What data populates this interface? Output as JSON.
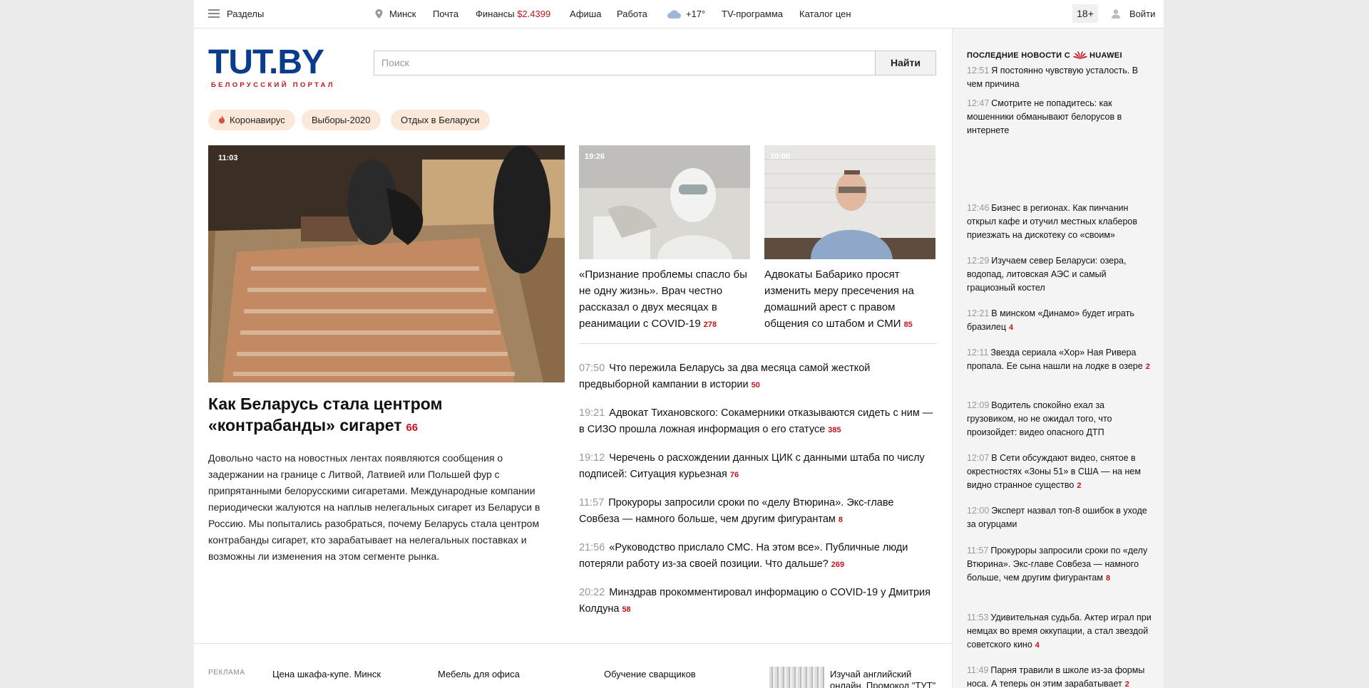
{
  "topbar": {
    "sections": "Разделы",
    "city": "Минск",
    "mail": "Почта",
    "finance_label": "Финансы",
    "finance_value": "$2.4399",
    "afisha": "Афиша",
    "work": "Работа",
    "weather": "+17°",
    "tv": "TV-программа",
    "catalog": "Каталог цен",
    "age": "18+",
    "login": "Войти"
  },
  "logo": {
    "word": "TUT.BY",
    "subtitle": "БЕЛОРУССКИЙ ПОРТАЛ"
  },
  "search": {
    "placeholder": "Поиск",
    "button": "Найти"
  },
  "tags": [
    "Коронавирус",
    "Выборы-2020",
    "Отдых в Беларуси"
  ],
  "hero": {
    "time": "11:03",
    "title": "Как Беларусь стала центром «контрабанды» сигарет",
    "count": "66",
    "text": "Довольно часто на новостных лентах появляются сообщения о задержании на границе с Литвой, Латвией или Польшей фур с припрятанными белорусскими сигаретами. Международные компании периодически жалуются на наплыв нелегальных сигарет из Беларуси в Россию. Мы попытались разобраться, почему Беларусь стала центром контрабанды сигарет, кто зарабатывает на нелегальных поставках и возможны ли изменения на этом сегменте рынка."
  },
  "cards": [
    {
      "time": "19:26",
      "title": "«Признание проблемы спасло бы не одну жизнь». Врач честно рассказал о двух месяцах в реанимации с COVID-19",
      "count": "278"
    },
    {
      "time": "10:00",
      "title": "Адвокаты Бабарико просят изменить меру пресечения на домашний арест с правом общения со штабом и СМИ",
      "count": "85"
    }
  ],
  "news": [
    {
      "time": "07:50",
      "title": "Что пережила Беларусь за два месяца самой жесткой предвыборной кампании в истории",
      "count": "50"
    },
    {
      "time": "19:21",
      "title": "Адвокат Тихановского: Сокамерники отказываются сидеть с ним — в СИЗО прошла ложная информация о его статусе",
      "count": "385"
    },
    {
      "time": "19:12",
      "title": "Черечень о расхождении данных ЦИК с данными штаба по числу подписей: Ситуация курьезная",
      "count": "76"
    },
    {
      "time": "11:57",
      "title": "Прокуроры запросили сроки по «делу Втюрина». Экс-главе Совбеза — намного больше, чем другим фигурантам",
      "count": "8"
    },
    {
      "time": "21:56",
      "title": "«Руководство прислало СМС. На этом все». Публичные люди потеряли работу из-за своей позиции. Что дальше?",
      "count": "269"
    },
    {
      "time": "20:22",
      "title": "Минздрав прокомментировал информацию о COVID-19 у Дмитрия Колдуна",
      "count": "58"
    }
  ],
  "sidebar": {
    "heading": "ПОСЛЕДНИЕ НОВОСТИ С",
    "brand": "HUAWEI",
    "items": [
      {
        "time": "12:51",
        "title": "Я постоянно чувствую усталость. В чем причина",
        "count": ""
      },
      {
        "time": "12:47",
        "title": "Смотрите не попадитесь: как мошенники обманывают белорусов в интернете",
        "count": ""
      },
      {
        "time": "12:46",
        "title": "Бизнес в регионах. Как пинчанин открыл кафе и отучил местных клаберов приезжать на дискотеку со «своим»",
        "count": ""
      },
      {
        "time": "12:29",
        "title": "Изучаем север Беларуси: озера, водопад, литовская АЭС и самый грациозный костел",
        "count": ""
      },
      {
        "time": "12:21",
        "title": "В минском «Динамо» будет играть бразилец",
        "count": "4"
      },
      {
        "time": "12:11",
        "title": "Звезда сериала «Хор» Ная Ривера пропала. Ее сына нашли на лодке в озере",
        "count": "2"
      },
      {
        "time": "12:09",
        "title": "Водитель спокойно ехал за грузовиком, но не ожидал того, что произойдет: видео опасного ДТП",
        "count": ""
      },
      {
        "time": "12:07",
        "title": "В Сети обсуждают видео, снятое в окрестностях «Зоны 51» в США — на нем видно странное существо",
        "count": "2"
      },
      {
        "time": "12:00",
        "title": "Эксперт назвал топ-8 ошибок в уходе за огурцами",
        "count": ""
      },
      {
        "time": "11:57",
        "title": "Прокуроры запросили сроки по «делу Втюрина». Экс-главе Совбеза — намного больше, чем другим фигурантам",
        "count": "8"
      },
      {
        "time": "11:53",
        "title": "Удивительная судьба. Актер играл при немцах во время оккупации, а стал звездой советского кино",
        "count": "4"
      },
      {
        "time": "11:49",
        "title": "Парня травили в школе из-за формы носа. А теперь он этим зарабатывает",
        "count": "2"
      }
    ]
  },
  "ads": {
    "label": "РЕКЛАМА",
    "items": [
      "Цена шкафа-купе. Минск",
      "Мебель для офиса",
      "Обучение сварщиков",
      "Изучай английский онлайн. Промокод \"ТУТ\""
    ]
  },
  "colors": {
    "accent": "#c4141d",
    "brand_blue": "#0a3c8c",
    "tag_bg": "#fbe8d8",
    "sidebar_bg": "#f4f4f4"
  }
}
